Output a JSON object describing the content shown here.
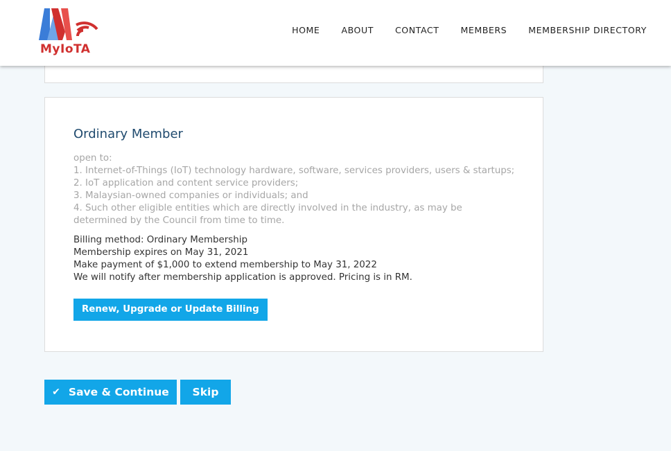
{
  "header": {
    "logo_text": "MyIoTA",
    "nav": [
      "HOME",
      "ABOUT",
      "CONTACT",
      "MEMBERS",
      "MEMBERSHIP DIRECTORY"
    ]
  },
  "card": {
    "title": "Ordinary Member",
    "description": [
      "open to:",
      "1. Internet-of-Things (IoT) technology hardware, software, services providers, users & startups;",
      "2. IoT application and content service providers;",
      "3. Malaysian-owned companies or individuals; and",
      "4. Such other eligible entities which are directly involved in the industry, as may be determined by the Council from time to time."
    ],
    "billing": [
      "Billing method: Ordinary Membership",
      "Membership expires on May 31, 2021",
      "Make payment of $1,000 to extend membership to May 31, 2022",
      "We will notify after membership application is approved. Pricing is in RM."
    ],
    "renew_label": "Renew, Upgrade or Update Billing"
  },
  "actions": {
    "save_label": "Save & Continue",
    "skip_label": "Skip"
  },
  "colors": {
    "accent": "#12a6e8",
    "title": "#1f4a6e",
    "muted": "#a6a6a6",
    "logo_red": "#d0302f",
    "logo_blue": "#3b7dd8"
  },
  "icons": {
    "save": "check-icon"
  }
}
